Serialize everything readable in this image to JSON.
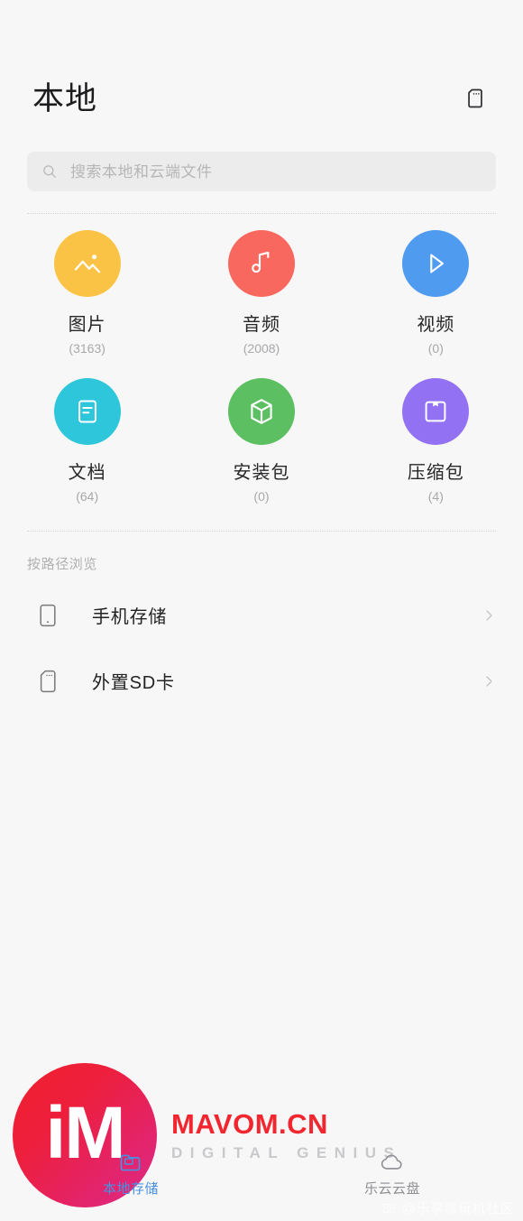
{
  "header": {
    "title": "本地",
    "action_icon": "sd-card-icon"
  },
  "search": {
    "placeholder": "搜索本地和云端文件",
    "value": "",
    "icon": "search-icon"
  },
  "categories": [
    {
      "label": "图片",
      "count": "(3163)",
      "icon": "image-icon",
      "color": "#fac346"
    },
    {
      "label": "音频",
      "count": "(2008)",
      "icon": "music-note-icon",
      "color": "#f9685f"
    },
    {
      "label": "视频",
      "count": "(0)",
      "icon": "play-icon",
      "color": "#4f9bf0"
    },
    {
      "label": "文档",
      "count": "(64)",
      "icon": "document-icon",
      "color": "#2ec6da"
    },
    {
      "label": "安装包",
      "count": "(0)",
      "icon": "package-cube-icon",
      "color": "#5cbf62"
    },
    {
      "label": "压缩包",
      "count": "(4)",
      "icon": "archive-box-icon",
      "color": "#9272f2"
    }
  ],
  "path_section": {
    "title": "按路径浏览",
    "items": [
      {
        "label": "手机存储",
        "icon": "phone-icon",
        "chevron": "chevron-right-icon"
      },
      {
        "label": "外置SD卡",
        "icon": "sd-card-icon",
        "chevron": "chevron-right-icon"
      }
    ]
  },
  "bottom_nav": {
    "items": [
      {
        "label": "本地存储",
        "icon": "folder-icon",
        "active": true
      },
      {
        "label": "乐云云盘",
        "icon": "cloud-icon",
        "active": false
      }
    ],
    "active_color": "#4a90e2",
    "inactive_color": "#8e8e93"
  },
  "watermark": {
    "badge_text": "iM",
    "title": "MAVOM.CN",
    "subtitle": "DIGITAL GENIUS",
    "corner_text": "@乐享派玩机社区",
    "title_color": "#f2262f"
  }
}
